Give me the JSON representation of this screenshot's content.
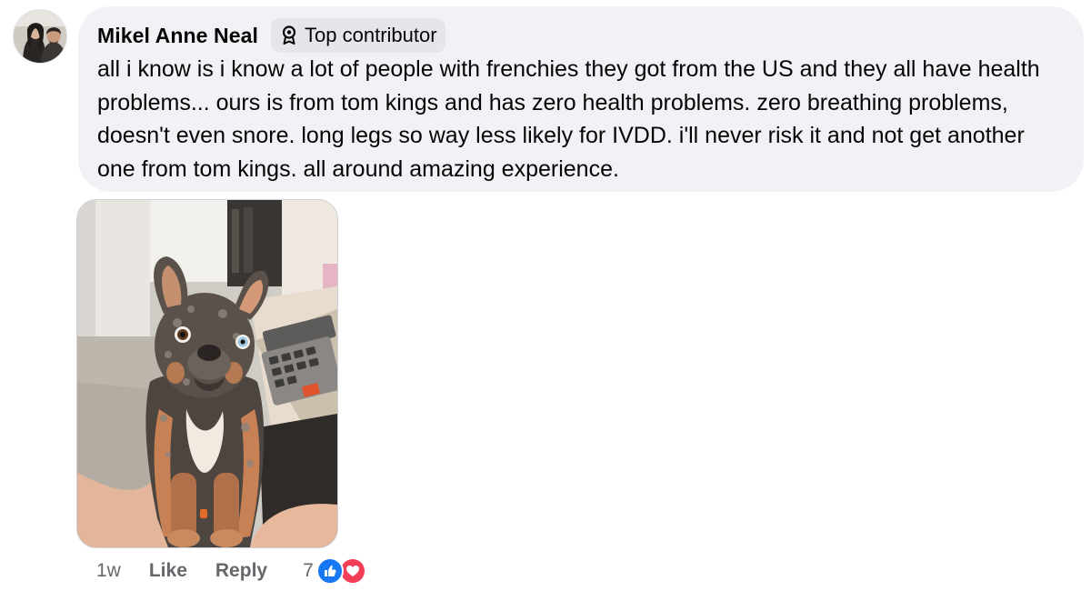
{
  "comment": {
    "author": "Mikel Anne Neal",
    "badge": {
      "label": "Top contributor",
      "icon": "contributor-badge-icon"
    },
    "text": "all i know is i know a lot of people with frenchies they got from the US and they all have health problems... ours is from tom kings and has zero health problems. zero breathing problems, doesn't even snore. long legs so way less likely for IVDD. i'll never risk it and not get another one from tom kings. all around amazing experience.",
    "avatar_icon": "profile-avatar",
    "photo_icon": "french-bulldog-photo"
  },
  "actions": {
    "timestamp": "1w",
    "like_label": "Like",
    "reply_label": "Reply",
    "reaction_count": "7",
    "reaction_icons": [
      "like-reaction-icon",
      "love-reaction-icon"
    ]
  },
  "colors": {
    "bubble_bg": "#f0f2f5",
    "badge_bg": "#e4e6eb",
    "meta_text": "#65676b",
    "like_blue": "#1877f2",
    "love_red": "#f33e58"
  }
}
